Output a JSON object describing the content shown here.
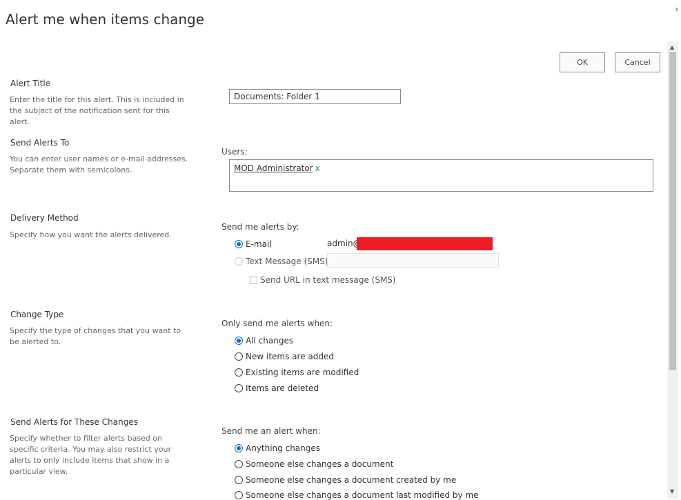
{
  "dialog": {
    "title": "Alert me when items change",
    "close_chevron": "›"
  },
  "buttons": {
    "ok": "OK",
    "cancel": "Cancel"
  },
  "sections": {
    "alert_title": {
      "title": "Alert Title",
      "description": "Enter the title for this alert. This is included in the subject of the notification sent for this alert.",
      "value": "Documents: Folder 1"
    },
    "send_to": {
      "title": "Send Alerts To",
      "description": "You can enter user names or e-mail addresses. Separate them with semicolons.",
      "users_label": "Users:",
      "user": "MOD Administrator",
      "remove": "x"
    },
    "delivery": {
      "title": "Delivery Method",
      "description": "Specify how you want the alerts delivered.",
      "label": "Send me alerts by:",
      "email_label": "E-mail",
      "email_value": "admin@",
      "sms_label": "Text Message (SMS)",
      "send_url_label": "Send URL in text message (SMS)"
    },
    "change_type": {
      "title": "Change Type",
      "description": "Specify the type of changes that you want to be alerted to.",
      "label": "Only send me alerts when:",
      "options": [
        "All changes",
        "New items are added",
        "Existing items are modified",
        "Items are deleted"
      ],
      "selected": "All changes"
    },
    "filters": {
      "title": "Send Alerts for These Changes",
      "description": "Specify whether to filter alerts based on specific criteria. You may also restrict your alerts to only include items that show in a particular view.",
      "label": "Send me an alert when:",
      "options": [
        "Anything changes",
        "Someone else changes a document",
        "Someone else changes a document created by me",
        "Someone else changes a document last modified by me"
      ],
      "selected": "Anything changes"
    }
  },
  "icons": {
    "chevron": "chevron-right-icon",
    "scroll_up": "scroll-up-arrow-icon",
    "scroll_down": "scroll-down-arrow-icon"
  },
  "colors": {
    "accent": "#0a6fd0",
    "redaction": "#ee1c25",
    "remove_x": "#2a8a7a"
  }
}
